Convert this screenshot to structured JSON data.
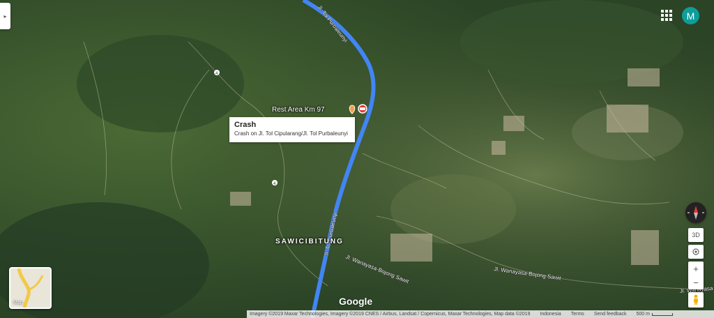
{
  "controls": {
    "panel_toggle": "▸",
    "avatar_letter": "M",
    "zoom_in": "+",
    "zoom_out": "−",
    "three_d": "3D"
  },
  "labels": {
    "road_north": "Jl. Tol Purbaleunyi",
    "road_south": "Jl. Tol Purbaleunyi",
    "road_wanayasa": "Jl. Wanayasa-Bojong Sawit",
    "road_wanayasa_east": "Jl. Wanayasa-Bojong Sawit",
    "road_east_edge": "Jl. Wanayasa",
    "village": "SAWICIBITUNG",
    "rest_area": "Rest Area Km 97",
    "route_4_a": "4",
    "route_4_b": "4"
  },
  "popup": {
    "title": "Crash",
    "subtitle": "Crash on Jl. Tol Cipularang/Jl. Tol Purbaleunyi"
  },
  "minimap_label": "Map",
  "logo": "Google",
  "footer": {
    "imagery": "Imagery ©2019 Maxar Technologies, Imagery ©2019 CNES / Airbus, Landsat / Copernicus, Maxar Technologies, Map data ©2019",
    "region": "Indonesia",
    "terms": "Terms",
    "feedback": "Send feedback",
    "scale": "500 m"
  },
  "colors": {
    "route": "#4285f4",
    "incident": "#e53935",
    "poi": "#f29e4c"
  },
  "icons": [
    "apps-grid-icon",
    "compass-icon",
    "my-location-icon",
    "pegman-icon",
    "crash-icon",
    "rest-area-icon"
  ]
}
